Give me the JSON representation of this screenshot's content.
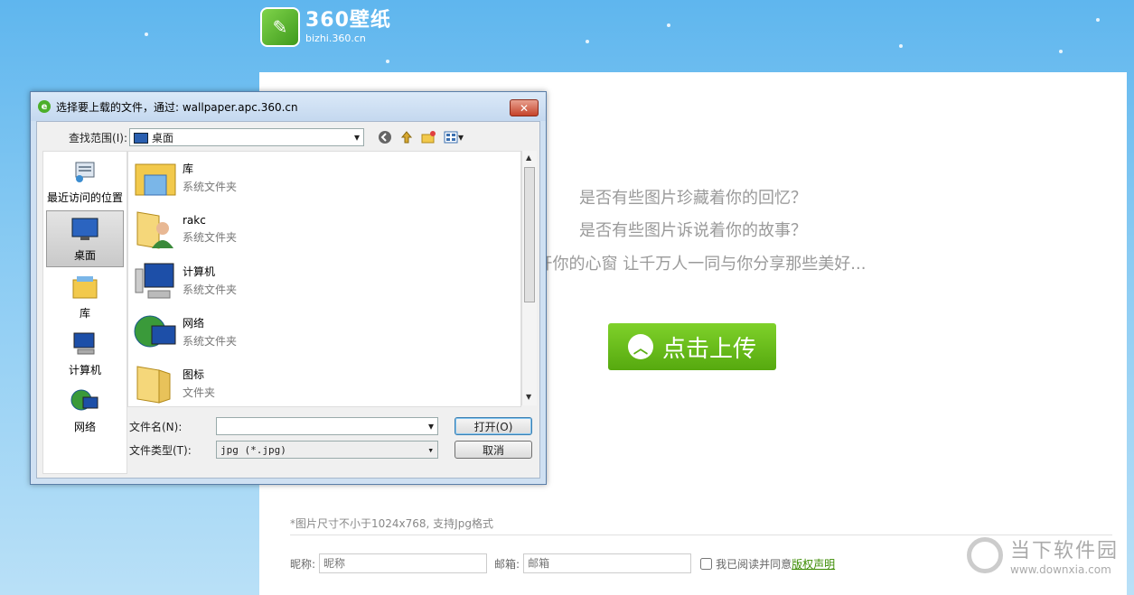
{
  "header": {
    "logo_title": "360壁纸",
    "logo_sub": "bizhi.360.cn"
  },
  "main": {
    "taglines": [
      "是否有些图片珍藏着你的回忆？",
      "是否有些图片诉说着你的故事？",
      "打开你的心窗 让千万人一同与你分享那些美好..."
    ],
    "upload_label": "点击上传",
    "note": "*图片尺寸不小于1024x768, 支持Jpg格式",
    "nickname_label": "昵称:",
    "nickname_placeholder": "昵称",
    "email_label": "邮箱:",
    "email_placeholder": "邮箱",
    "agree_text": "我已阅读并同意",
    "copyright_link": "版权声明"
  },
  "watermark": {
    "title": "当下软件园",
    "sub": "www.downxia.com"
  },
  "dialog": {
    "title": "选择要上载的文件，通过: wallpaper.apc.360.cn",
    "close_label": "✕",
    "lookin_label": "查找范围(I):",
    "lookin_value": "桌面",
    "places": [
      {
        "label": "最近访问的位置",
        "icon": "recent-places-icon"
      },
      {
        "label": "桌面",
        "icon": "desktop-icon",
        "selected": true
      },
      {
        "label": "库",
        "icon": "library-icon"
      },
      {
        "label": "计算机",
        "icon": "computer-icon"
      },
      {
        "label": "网络",
        "icon": "network-icon"
      }
    ],
    "files": [
      {
        "name": "库",
        "type": "系统文件夹",
        "icon": "library-folder-icon"
      },
      {
        "name": "rakc",
        "type": "系统文件夹",
        "icon": "user-folder-icon"
      },
      {
        "name": "计算机",
        "type": "系统文件夹",
        "icon": "computer-icon"
      },
      {
        "name": "网络",
        "type": "系统文件夹",
        "icon": "network-icon"
      },
      {
        "name": "图标",
        "type": "文件夹",
        "icon": "folder-icon"
      }
    ],
    "filename_label": "文件名(N):",
    "filename_value": "",
    "filetype_label": "文件类型(T):",
    "filetype_value": "jpg (*.jpg)",
    "open_label": "打开(O)",
    "cancel_label": "取消"
  },
  "colors": {
    "accent_green": "#5aae12",
    "sky_blue": "#5fb6ee"
  }
}
